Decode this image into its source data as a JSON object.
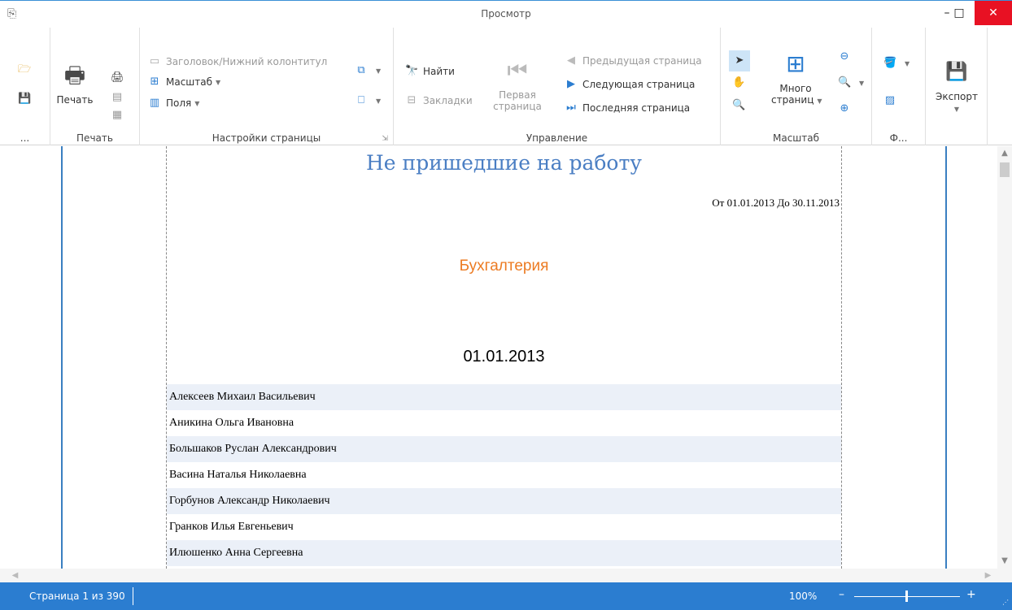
{
  "window": {
    "title": "Просмотр",
    "minimize": "–",
    "maximize": "□",
    "close": "✕"
  },
  "ribbon": {
    "file_group": {
      "label": "..."
    },
    "print_group": {
      "label": "Печать",
      "print_button": "Печать"
    },
    "page_setup": {
      "label": "Настройки страницы",
      "header_footer": "Заголовок/Нижний колонтитул",
      "scale": "Масштаб",
      "margins": "Поля"
    },
    "navigation": {
      "label": "Управление",
      "find": "Найти",
      "bookmarks": "Закладки",
      "first_page_line1": "Первая",
      "first_page_line2": "страница",
      "prev_page": "Предыдущая страница",
      "next_page": "Следующая страница",
      "last_page": "Последняя страница"
    },
    "zoom_group": {
      "label": "Масштаб",
      "many_pages_line1": "Много",
      "many_pages_line2": "страниц"
    },
    "background_group": {
      "label": "Ф..."
    },
    "export": {
      "label": "Экспорт"
    }
  },
  "report": {
    "title": "Не пришедшие на работу",
    "date_range": "От 01.01.2013 До 30.11.2013",
    "department": "Бухгалтерия",
    "date": "01.01.2013",
    "employees": [
      "Алексеев Михаил Васильевич",
      "Аникина Ольга Ивановна",
      "Большаков Руслан Александрович",
      "Васина Наталья Николаевна",
      "Горбунов Александр Николаевич",
      "Гранков Илья Евгеньевич",
      "Илюшенко Анна Сергеевна"
    ]
  },
  "status": {
    "page_info": "Страница 1 из 390",
    "zoom": "100%",
    "minus": "–",
    "plus": "+"
  },
  "colors": {
    "accent": "#2b7dd0",
    "title": "#4a7ec3",
    "department": "#ec7b22",
    "row_alt": "#ebf0f8"
  }
}
